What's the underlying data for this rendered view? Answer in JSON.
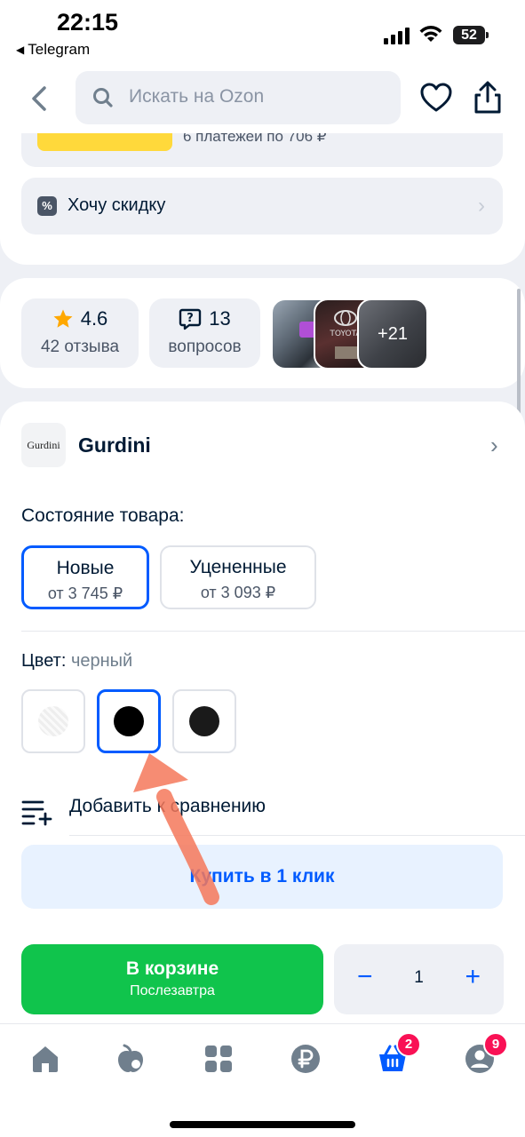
{
  "status_bar": {
    "time": "22:15",
    "back_app": "Telegram",
    "battery": "52"
  },
  "header": {
    "search_placeholder": "Искать на Ozon"
  },
  "installment": {
    "text": "6 платежей по 706 ₽"
  },
  "discount": {
    "label": "Хочу скидку"
  },
  "rating": {
    "value": "4.6",
    "reviews": "42 отзыва"
  },
  "questions": {
    "count": "13",
    "label": "вопросов"
  },
  "photos": {
    "more": "+21"
  },
  "brand": {
    "name": "Gurdini",
    "logo_text": "Gurdini"
  },
  "condition": {
    "label": "Состояние товара:",
    "options": [
      {
        "title": "Новые",
        "price": "от 3 745 ₽",
        "selected": true
      },
      {
        "title": "Уцененные",
        "price": "от 3 093 ₽",
        "selected": false
      }
    ]
  },
  "color": {
    "label": "Цвет:",
    "value": "черный",
    "swatches": [
      {
        "name": "clear",
        "color": "#f0f0f0",
        "selected": false
      },
      {
        "name": "black",
        "color": "#000000",
        "selected": true
      },
      {
        "name": "black-2",
        "color": "#1a1a1a",
        "selected": false
      }
    ]
  },
  "compare": {
    "label": "Добавить к сравнению"
  },
  "buy_one_click": {
    "label": "Купить в 1 клик"
  },
  "cart_button": {
    "label": "В корзине",
    "sublabel": "Послезавтра"
  },
  "quantity": {
    "minus": "−",
    "value": "1",
    "plus": "+"
  },
  "tabbar": {
    "items": [
      {
        "name": "home",
        "icon": "home-icon"
      },
      {
        "name": "fresh",
        "icon": "apple-icon"
      },
      {
        "name": "catalog",
        "icon": "grid-icon"
      },
      {
        "name": "finance",
        "icon": "ruble-icon"
      },
      {
        "name": "cart",
        "icon": "cart-icon",
        "badge": "2"
      },
      {
        "name": "profile",
        "icon": "profile-icon",
        "badge": "9"
      }
    ]
  },
  "colors": {
    "accent": "#005bff",
    "green": "#10c44c",
    "badge": "#f91155",
    "annotation": "#f5785a"
  }
}
